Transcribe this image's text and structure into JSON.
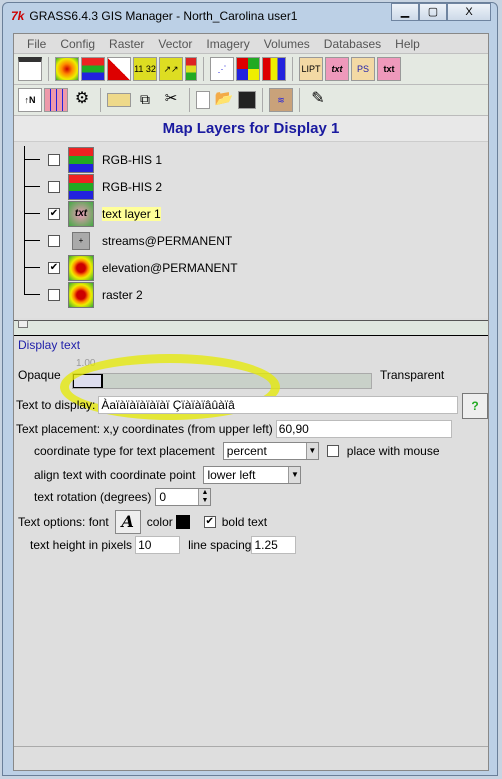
{
  "window": {
    "title": "GRASS6.4.3 GIS Manager - North_Carolina user1",
    "min": "▁",
    "max": "▢",
    "close": "X"
  },
  "menu": [
    "File",
    "Config",
    "Raster",
    "Vector",
    "Imagery",
    "Volumes",
    "Databases",
    "Help"
  ],
  "toolbar1": [
    "display-monitor",
    "raster",
    "rgb-his",
    "histogram",
    "raster-legend-numbers",
    "raster-arrows",
    "raster-legend",
    "vector",
    "vector-thematic",
    "vector-chart",
    "labels",
    "text",
    "postscript",
    "postscript-text"
  ],
  "toolbar2": [
    "north-arrow-scale",
    "grid",
    "gear",
    "new-group",
    "copy",
    "cut",
    "new-file",
    "open",
    "save",
    "digitize",
    "georectify"
  ],
  "header": "Map Layers for Display 1",
  "layers": [
    {
      "label": "RGB-HIS 1",
      "checked": false,
      "icon": "rgb-his-icon"
    },
    {
      "label": "RGB-HIS 2",
      "checked": false,
      "icon": "rgb-his-icon"
    },
    {
      "label": "text layer 1",
      "checked": true,
      "icon": "text-layer-icon",
      "selected": true
    },
    {
      "label": "streams@PERMANENT",
      "checked": false,
      "icon": "vector-icon"
    },
    {
      "label": "elevation@PERMANENT",
      "checked": true,
      "icon": "raster-icon"
    },
    {
      "label": "raster 2",
      "checked": false,
      "icon": "raster-icon"
    }
  ],
  "panel": {
    "title": "Display text",
    "opaque": "Opaque",
    "transparent": "Transparent",
    "opacity_value": "1.00",
    "text_label": "Text to display:",
    "text_value": "Àaïàïàïàïàïàï Çïàïàïâûàïâ",
    "placement_label": "Text placement: x,y coordinates (from upper left)",
    "placement_value": "60,90",
    "coord_type_label": "coordinate type for text placement",
    "coord_type_value": "percent",
    "mouse_label": "place with mouse",
    "mouse_checked": false,
    "align_label": "align text with coordinate point",
    "align_value": "lower left",
    "rotation_label": "text rotation (degrees)",
    "rotation_value": "0",
    "font_label": "Text options: font",
    "color_label": "color",
    "text_color": "#000000",
    "bold_label": "bold text",
    "bold_checked": true,
    "height_label": "text height in pixels",
    "height_value": "10",
    "spacing_label": "line spacing",
    "spacing_value": "1.25"
  },
  "highlight_color": "#e6ea00"
}
